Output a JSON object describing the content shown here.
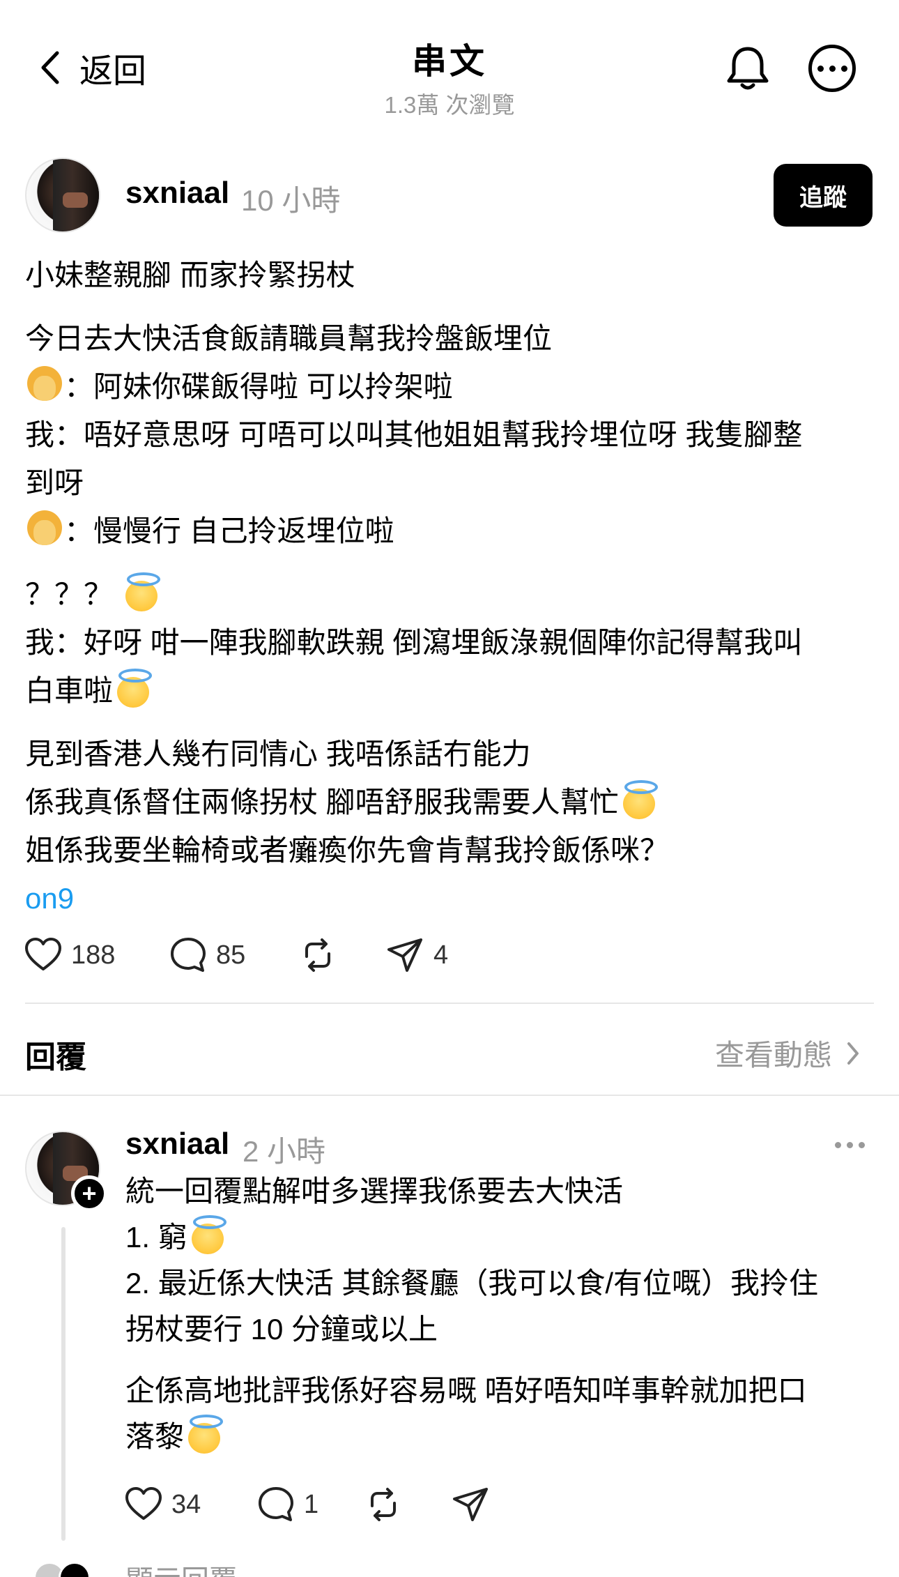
{
  "header": {
    "back_label": "返回",
    "title": "串文",
    "views": "1.3萬 次瀏覽"
  },
  "post": {
    "username": "sxniaal",
    "time": "10 小時",
    "follow_label": "追蹤",
    "lines": {
      "l1": "小妹整親腳 而家拎緊拐杖",
      "l2": "今日去大快活食飯請職員幫我拎盤飯埋位",
      "l3": "：阿妹你碟飯得啦 可以拎架啦",
      "l4a": "我：唔好意思呀 可唔可以叫其他姐姐幫我拎埋位呀 我隻腳整",
      "l4b": "到呀",
      "l5": "：慢慢行 自己拎返埋位啦",
      "l6": "？？？ ",
      "l7a": "我：好呀 咁一陣我腳軟跌親 倒瀉埋飯淥親個陣你記得幫我叫",
      "l7b": "白車啦",
      "l8": "見到香港人幾冇同情心 我唔係話冇能力",
      "l9": "係我真係督住兩條拐杖 腳唔舒服我需要人幫忙",
      "l10": "姐係我要坐輪椅或者癱瘓你先會肯幫我拎飯係咪？",
      "link": "on9"
    },
    "likes": "188",
    "comments": "85",
    "shares": "4"
  },
  "replies_section": {
    "title": "回覆",
    "activity_label": "查看動態"
  },
  "reply": {
    "username": "sxniaal",
    "time": "2 小時",
    "lines": {
      "r1": "統一回覆點解咁多選擇我係要去大快活",
      "r2": "1. 窮",
      "r3a": "2. 最近係大快活 其餘餐廳（我可以食/有位嘅）我拎住",
      "r3b": "拐杖要行 10 分鐘或以上",
      "r4a": "企係高地批評我係好容易嘅 唔好唔知咩事幹就加把口",
      "r4b": "落黎"
    },
    "likes": "34",
    "comments": "1",
    "show_replies": "顯示回覆"
  },
  "icons": {
    "back": "chevron-left-icon",
    "bell": "bell-icon",
    "more": "more-icon",
    "heart": "heart-icon",
    "comment": "comment-icon",
    "repost": "repost-icon",
    "send": "send-icon"
  },
  "colors": {
    "link": "#1a9cf0",
    "muted": "#999999",
    "follow_bg": "#000000"
  }
}
